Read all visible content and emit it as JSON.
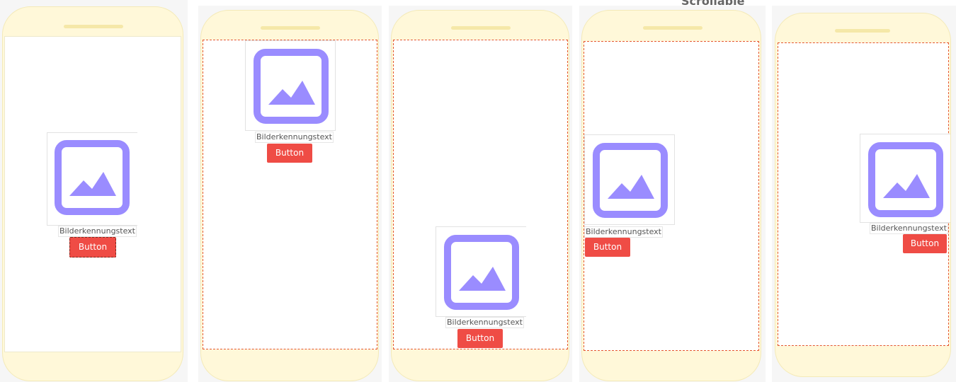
{
  "colors": {
    "phone_body": "#fff8d9",
    "screen": "#ffffff",
    "selection_dash": "#e4572e",
    "button": "#ef4c45",
    "image_icon": "#9a8cff"
  },
  "header": {
    "label": "Scrollable"
  },
  "frames": [
    {
      "image_icon": "image-placeholder-icon",
      "caption": "Bilderkennungstext",
      "button_label": "Button",
      "alignment": "center"
    },
    {
      "image_icon": "image-placeholder-icon",
      "caption": "Bilderkennungstext",
      "button_label": "Button",
      "alignment": "top-center"
    },
    {
      "image_icon": "image-placeholder-icon",
      "caption": "Bilderkennungstext",
      "button_label": "Button",
      "alignment": "bottom-center"
    },
    {
      "image_icon": "image-placeholder-icon",
      "caption": "Bilderkennungstext",
      "button_label": "Button",
      "alignment": "center-left"
    },
    {
      "image_icon": "image-placeholder-icon",
      "caption": "Bilderkennungstext",
      "button_label": "Button",
      "alignment": "center-right"
    }
  ]
}
